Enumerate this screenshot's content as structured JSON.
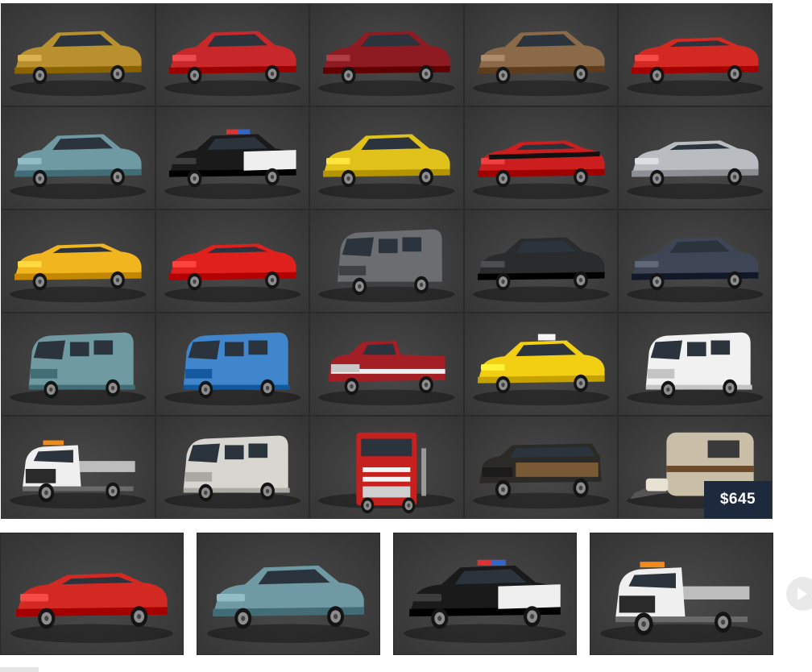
{
  "grid": {
    "items": [
      {
        "icon": "golden-firebird-car-icon",
        "kind": "coupe",
        "color": "#b8912e"
      },
      {
        "icon": "red-chevy-bel-air-car-icon",
        "kind": "classic",
        "color": "#c8282a"
      },
      {
        "icon": "maroon-classic-sedan-car-icon",
        "kind": "classic",
        "color": "#8e1a22"
      },
      {
        "icon": "bronze-toronado-car-icon",
        "kind": "coupe",
        "color": "#8a6a48"
      },
      {
        "icon": "red-camaro-car-icon",
        "kind": "sport",
        "color": "#d22a22"
      },
      {
        "icon": "teal-caprice-sedan-car-icon",
        "kind": "sedan",
        "color": "#6f9aa4"
      },
      {
        "icon": "police-sedan-car-icon",
        "kind": "police",
        "color": "#1a1a1a"
      },
      {
        "icon": "yellow-taxi-sedan-car-icon",
        "kind": "sedan",
        "color": "#e1c21a"
      },
      {
        "icon": "red-chevelle-car-icon",
        "kind": "muscle",
        "color": "#cc1e1e"
      },
      {
        "icon": "silver-corvette-c2-car-icon",
        "kind": "sport",
        "color": "#b9bcc0"
      },
      {
        "icon": "yellow-corvette-c3-car-icon",
        "kind": "sport",
        "color": "#f1b51f"
      },
      {
        "icon": "red-corvette-c4-car-icon",
        "kind": "sport",
        "color": "#e0201c"
      },
      {
        "icon": "gray-step-van-truck-icon",
        "kind": "stepvan",
        "color": "#6b6d70"
      },
      {
        "icon": "black-charger-car-icon",
        "kind": "sedan",
        "color": "#2a2b2d"
      },
      {
        "icon": "navy-crown-victoria-car-icon",
        "kind": "sedan",
        "color": "#3e4656"
      },
      {
        "icon": "teal-econoline-van-icon",
        "kind": "van",
        "color": "#6f9aa2"
      },
      {
        "icon": "blue-white-chevy-van-icon",
        "kind": "van",
        "color": "#3f86cc"
      },
      {
        "icon": "red-white-pickup-truck-icon",
        "kind": "pickup",
        "color": "#a31e25"
      },
      {
        "icon": "yellow-crown-victoria-taxi-icon",
        "kind": "taxi",
        "color": "#f3cf14"
      },
      {
        "icon": "white-express-van-icon",
        "kind": "van",
        "color": "#f1f1f1"
      },
      {
        "icon": "white-tow-truck-icon",
        "kind": "tow",
        "color": "#efefef"
      },
      {
        "icon": "white-chevy-van-icon",
        "kind": "van",
        "color": "#d8d6d0"
      },
      {
        "icon": "red-semi-truck-cab-icon",
        "kind": "semi",
        "color": "#c7211f"
      },
      {
        "icon": "black-grand-wagoneer-icon",
        "kind": "wagon",
        "color": "#2c2a26"
      },
      {
        "icon": "camper-trailer-icon",
        "kind": "trailer",
        "color": "#c9bfa8"
      }
    ],
    "price": "$645"
  },
  "thumbnails": [
    {
      "icon": "red-camaro-thumbnail-icon",
      "kind": "sport",
      "color": "#d22a22"
    },
    {
      "icon": "teal-caprice-thumbnail-icon",
      "kind": "sedan",
      "color": "#6f9aa4"
    },
    {
      "icon": "police-sedan-thumbnail-icon",
      "kind": "police",
      "color": "#1a1a1a"
    },
    {
      "icon": "white-tow-truck-thumbnail-icon",
      "kind": "tow",
      "color": "#efefef"
    }
  ],
  "next_button": {
    "icon": "play-next-icon"
  }
}
